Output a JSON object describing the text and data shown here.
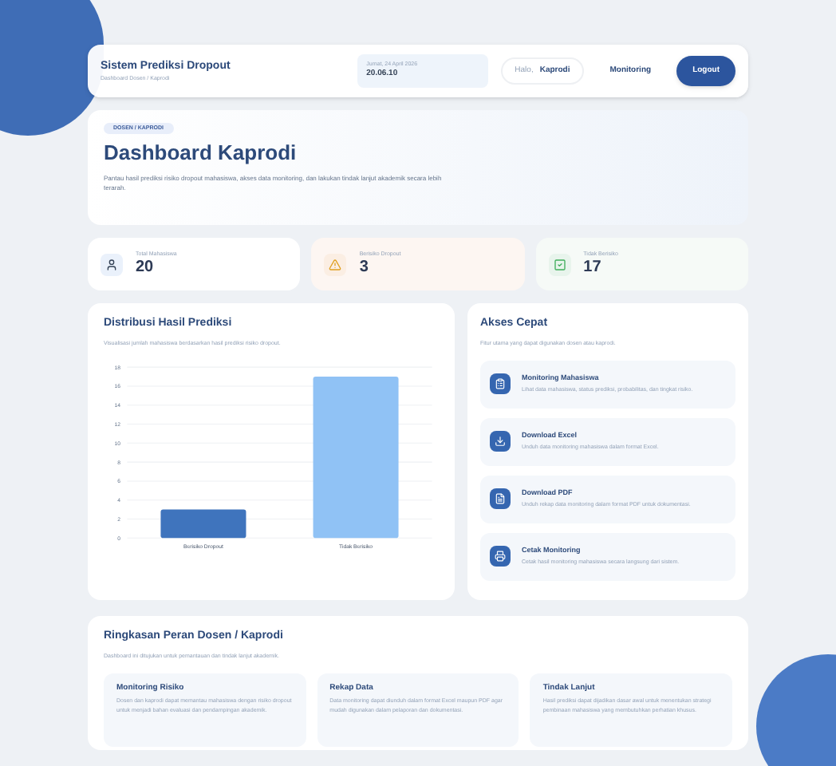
{
  "header": {
    "title": "Sistem Prediksi Dropout",
    "subtitle": "Dashboard Dosen / Kaprodi",
    "date": "Jumat, 24 April 2026",
    "time": "20.06.10",
    "greeting": "Halo,",
    "user": "Kaprodi",
    "nav": [
      {
        "label": "Monitoring",
        "kind": "link"
      },
      {
        "label": "Logout",
        "kind": "primary"
      }
    ]
  },
  "hero": {
    "badge": "DOSEN / KAPRODI",
    "title": "Dashboard Kaprodi",
    "description": "Pantau hasil prediksi risiko dropout mahasiswa, akses data monitoring, dan lakukan tindak lanjut akademik secara lebih terarah."
  },
  "stats": [
    {
      "label": "Total Mahasiswa",
      "value": "20",
      "kind": "total"
    },
    {
      "label": "Berisiko Dropout",
      "value": "3",
      "kind": "risk"
    },
    {
      "label": "Tidak Berisiko",
      "value": "17",
      "kind": "safe"
    }
  ],
  "distribution": {
    "title": "Distribusi Hasil Prediksi",
    "subtitle": "Visualisasi jumlah mahasiswa berdasarkan hasil prediksi risiko dropout.",
    "chart_data": {
      "type": "bar",
      "categories": [
        "Berisiko Dropout",
        "Tidak Berisiko"
      ],
      "series": [
        {
          "color": "#3f74bd",
          "values": [
            3,
            null
          ]
        },
        {
          "color": "#90c2f5",
          "values": [
            null,
            17
          ]
        }
      ],
      "grid": true,
      "ylim": [
        0,
        18
      ],
      "yticks": [
        0,
        2,
        4,
        6,
        8,
        10,
        12,
        14,
        16,
        18
      ]
    }
  },
  "quick_access": {
    "title": "Akses Cepat",
    "subtitle": "Fitur utama yang dapat digunakan dosen atau kaprodi.",
    "items": [
      {
        "title": "Monitoring Mahasiswa",
        "description": "Lihat data mahasiswa, status prediksi, probabilitas, dan tingkat risiko.",
        "kind": "monitor"
      },
      {
        "title": "Download Excel",
        "description": "Unduh data monitoring mahasiswa dalam format Excel.",
        "kind": "excel"
      },
      {
        "title": "Download PDF",
        "description": "Unduh rekap data monitoring dalam format PDF untuk dokumentasi.",
        "kind": "pdf"
      },
      {
        "title": "Cetak Monitoring",
        "description": "Cetak hasil monitoring mahasiswa secara langsung dari sistem.",
        "kind": "print"
      }
    ]
  },
  "summary": {
    "title": "Ringkasan Peran Dosen / Kaprodi",
    "subtitle": "Dashboard ini ditujukan untuk pemantauan dan tindak lanjut akademik.",
    "cards": [
      {
        "title": "Monitoring Risiko",
        "description": "Dosen dan kaprodi dapat memantau mahasiswa dengan risiko dropout untuk menjadi bahan evaluasi dan pendampingan akademik."
      },
      {
        "title": "Rekap Data",
        "description": "Data monitoring dapat diunduh dalam format Excel maupun PDF agar mudah digunakan dalam pelaporan dan dokumentasi."
      },
      {
        "title": "Tindak Lanjut",
        "description": "Hasil prediksi dapat dijadikan dasar awal untuk menentukan strategi pembinaan mahasiswa yang membutuhkan perhatian khusus."
      }
    ]
  }
}
